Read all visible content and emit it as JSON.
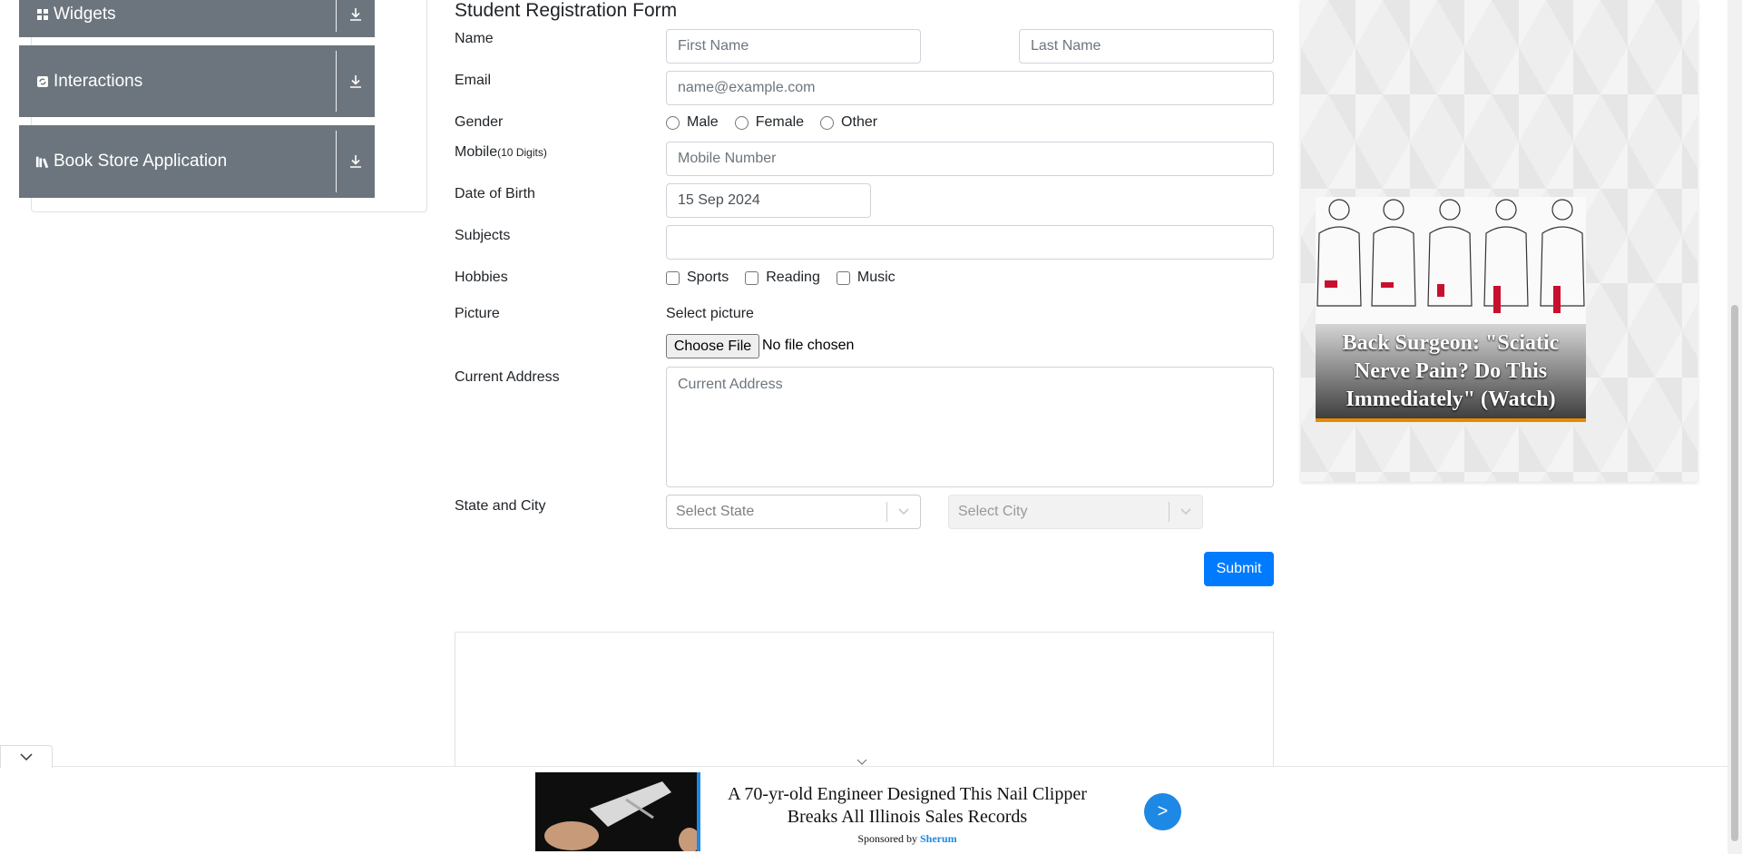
{
  "sidebar": {
    "groups": [
      {
        "label": "Widgets",
        "icon": "widgets-icon"
      },
      {
        "label": "Interactions",
        "icon": "interactions-icon"
      },
      {
        "label": "Book Store Application",
        "icon": "book-store-icon"
      }
    ]
  },
  "form": {
    "title": "Student Registration Form",
    "name_label": "Name",
    "first_name_placeholder": "First Name",
    "last_name_placeholder": "Last Name",
    "email_label": "Email",
    "email_placeholder": "name@example.com",
    "gender_label": "Gender",
    "gender_options": [
      "Male",
      "Female",
      "Other"
    ],
    "mobile_label": "Mobile",
    "mobile_hint": "(10 Digits)",
    "mobile_placeholder": "Mobile Number",
    "dob_label": "Date of Birth",
    "dob_value": "15 Sep 2024",
    "subjects_label": "Subjects",
    "hobbies_label": "Hobbies",
    "hobbies_options": [
      "Sports",
      "Reading",
      "Music"
    ],
    "picture_label": "Picture",
    "picture_select_text": "Select picture",
    "choose_file_label": "Choose File",
    "no_file_text": "No file chosen",
    "address_label": "Current Address",
    "address_placeholder": "Current Address",
    "state_city_label": "State and City",
    "state_placeholder": "Select State",
    "city_placeholder": "Select City",
    "submit_label": "Submit"
  },
  "ads": {
    "right_headline": "Back Surgeon: \"Sciatic Nerve Pain? Do This Immediately\" (Watch)",
    "bottom_headline": "A 70-yr-old Engineer Designed This Nail Clipper Breaks All Illinois Sales Records",
    "bottom_sponsor_prefix": "Sponsored by",
    "bottom_sponsor_name": "Sherum",
    "bottom_go": ">"
  },
  "colors": {
    "menu_bg": "#6c757d",
    "primary": "#007bff",
    "ad_accent": "#1e88e5"
  }
}
